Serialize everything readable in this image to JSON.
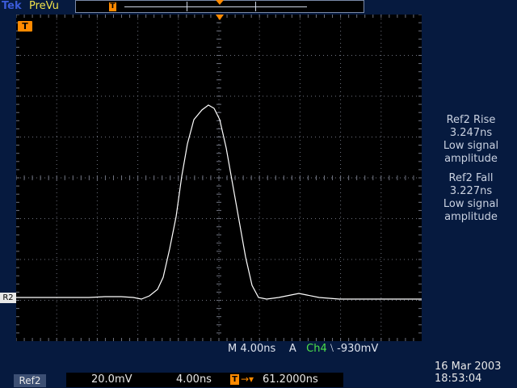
{
  "header": {
    "brand": "Tek",
    "mode": "PreVu",
    "record_trigger_glyph": "T"
  },
  "markers": {
    "trigger_level_glyph": "T",
    "ref_channel": "R2"
  },
  "measurements": [
    {
      "title": "Ref2 Rise",
      "value": "3.247ns",
      "note_line1": "Low signal",
      "note_line2": "amplitude"
    },
    {
      "title": "Ref2 Fall",
      "value": "3.227ns",
      "note_line1": "Low signal",
      "note_line2": "amplitude"
    }
  ],
  "horizontal": {
    "timebase_prefix": "M",
    "timebase": "4.00ns",
    "trigger_mode": "A",
    "trigger_source": "Ch4",
    "trigger_slope": "⧵",
    "trigger_level": "-930mV"
  },
  "status": {
    "ref_label": "Ref2",
    "volts_div": "20.0mV",
    "time_div": "4.00ns",
    "delay_glyph": "T",
    "delay_arrow": "→▾",
    "delay": "61.2000ns"
  },
  "datetime": {
    "date": "16 Mar 2003",
    "time": "18:53:04"
  },
  "colors": {
    "background": "#061a3f",
    "graticule": "#000000",
    "trace": "#ffffff",
    "trigger": "#ff8a00",
    "channel4": "#4be04b"
  }
}
